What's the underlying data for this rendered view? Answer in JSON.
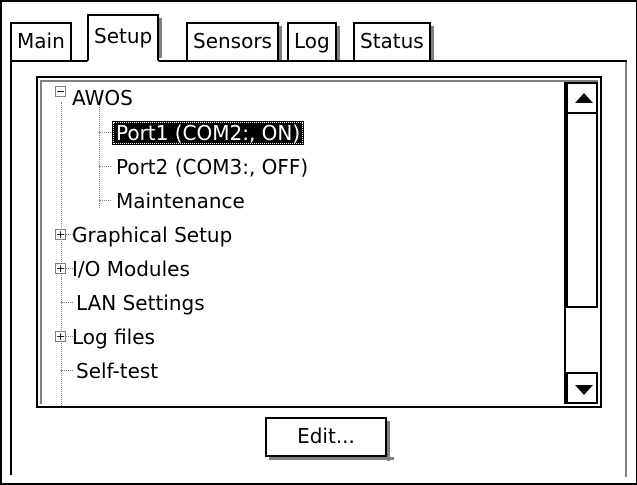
{
  "tabs": [
    "Main",
    "Setup",
    "Sensors",
    "Log",
    "Status"
  ],
  "active_tab": "Setup",
  "tree": {
    "items": [
      {
        "label": "AWOS",
        "expander": "−",
        "level": 0
      },
      {
        "label": "Port1 (COM2:, ON)",
        "level": 1,
        "selected": true
      },
      {
        "label": "Port2 (COM3:, OFF)",
        "level": 1
      },
      {
        "label": "Maintenance",
        "level": 1
      },
      {
        "label": "Graphical Setup",
        "expander": "+",
        "level": 0
      },
      {
        "label": "I/O Modules",
        "expander": "+",
        "level": 0
      },
      {
        "label": "LAN Settings",
        "level": 0
      },
      {
        "label": "Log files",
        "expander": "+",
        "level": 0
      },
      {
        "label": "Self-test",
        "level": 0
      }
    ]
  },
  "scrollbar": {
    "up_icon": "arrow-up-icon",
    "down_icon": "arrow-down-icon"
  },
  "buttons": {
    "edit_label": "Edit..."
  },
  "colors": {
    "selection": "#000000",
    "border": "#000000",
    "shadow": "#808080"
  }
}
